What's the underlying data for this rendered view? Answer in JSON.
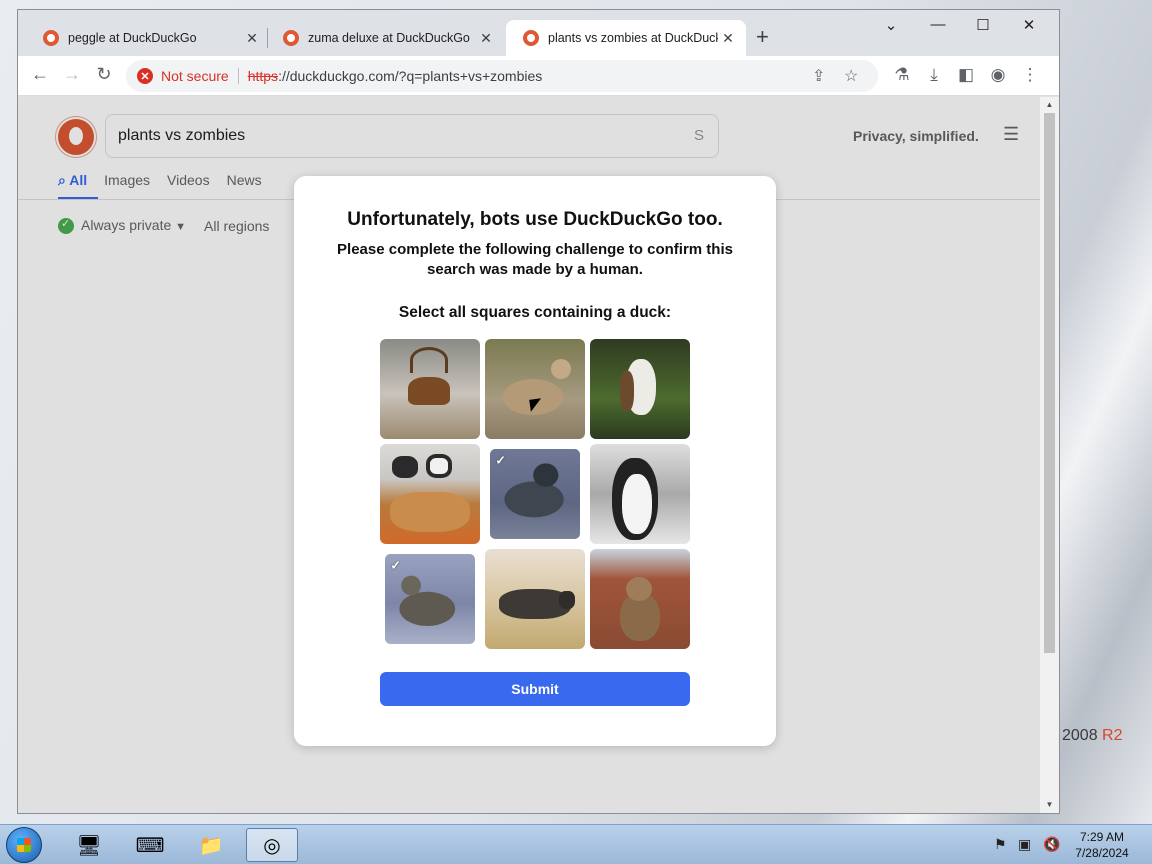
{
  "desktop": {
    "brand_year": "2008",
    "brand_suffix": "R2"
  },
  "browser": {
    "tabs": [
      {
        "title": "peggle at DuckDuckGo",
        "active": false
      },
      {
        "title": "zuma deluxe at DuckDuckGo",
        "active": false
      },
      {
        "title": "plants vs zombies at DuckDuckGo",
        "active": true
      }
    ],
    "security_label": "Not secure",
    "url_scheme": "https",
    "url_rest": "://duckduckgo.com/?q=plants+vs+zombies"
  },
  "page": {
    "search_value": "plants vs zombies",
    "search_suffix": "S",
    "tagline": "Privacy, simplified.",
    "tabs": [
      "All",
      "Images",
      "Videos",
      "News"
    ],
    "filters": {
      "privacy": "Always private",
      "privacy_caret": "▼",
      "region": "All regions"
    }
  },
  "modal": {
    "title": "Unfortunately, bots use DuckDuckGo too.",
    "subtitle": "Please complete the following challenge to confirm this search was made by a human.",
    "prompt": "Select all squares containing a duck:",
    "tiles": [
      {
        "subject": "deer",
        "selected": false
      },
      {
        "subject": "duck",
        "selected": false
      },
      {
        "subject": "eagle",
        "selected": false
      },
      {
        "subject": "cat-and-puppies",
        "selected": false
      },
      {
        "subject": "duck",
        "selected": true
      },
      {
        "subject": "penguin",
        "selected": false
      },
      {
        "subject": "duck",
        "selected": true
      },
      {
        "subject": "rhino",
        "selected": false
      },
      {
        "subject": "monkey",
        "selected": false
      }
    ],
    "selected_mark": "✓",
    "submit_label": "Submit"
  },
  "taskbar": {
    "time": "7:29 AM",
    "date": "7/28/2024"
  }
}
